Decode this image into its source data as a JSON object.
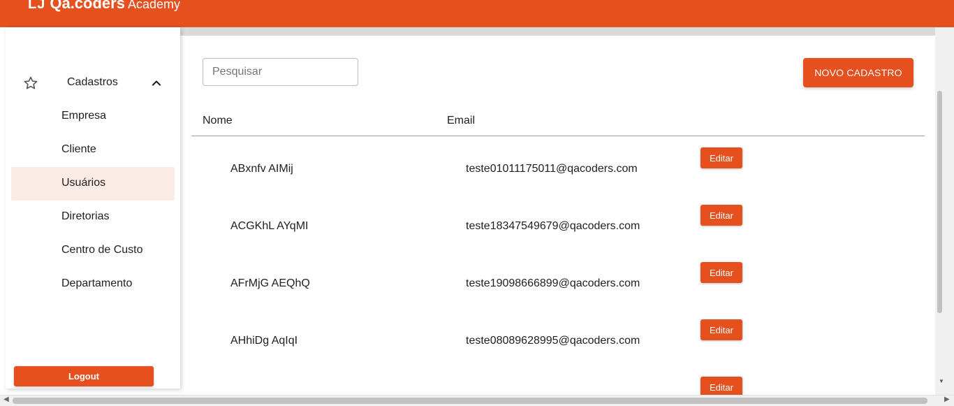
{
  "brand": {
    "mark": "LJ",
    "name": "Qa.coders",
    "sub": "Academy"
  },
  "sidebar": {
    "group_label": "Cadastros",
    "items": [
      {
        "label": "Empresa",
        "active": false
      },
      {
        "label": "Cliente",
        "active": false
      },
      {
        "label": "Usuários",
        "active": true
      },
      {
        "label": "Diretorias",
        "active": false
      },
      {
        "label": "Centro de Custo",
        "active": false
      },
      {
        "label": "Departamento",
        "active": false
      }
    ],
    "logout_label": "Logout"
  },
  "search": {
    "placeholder": "Pesquisar"
  },
  "new_button_label": "NOVO CADASTRO",
  "table": {
    "headers": [
      "Nome",
      "Email"
    ],
    "rows": [
      {
        "name": "ABxnfv AIMij",
        "email": "teste01011175011@qacoders.com",
        "action": "Editar"
      },
      {
        "name": "ACGKhL AYqMI",
        "email": "teste18347549679@qacoders.com",
        "action": "Editar"
      },
      {
        "name": "AFrMjG AEQhQ",
        "email": "teste19098666899@qacoders.com",
        "action": "Editar"
      },
      {
        "name": "AHhiDg AqIqI",
        "email": "teste08089628995@qacoders.com",
        "action": "Editar"
      },
      {
        "name": "",
        "email": "",
        "action": "Editar"
      }
    ]
  },
  "colors": {
    "accent": "#e64f1e",
    "active_item_bg": "#fbece6"
  },
  "icons": {
    "group": "star-outline-icon",
    "group_toggle": "chevron-up-icon"
  }
}
